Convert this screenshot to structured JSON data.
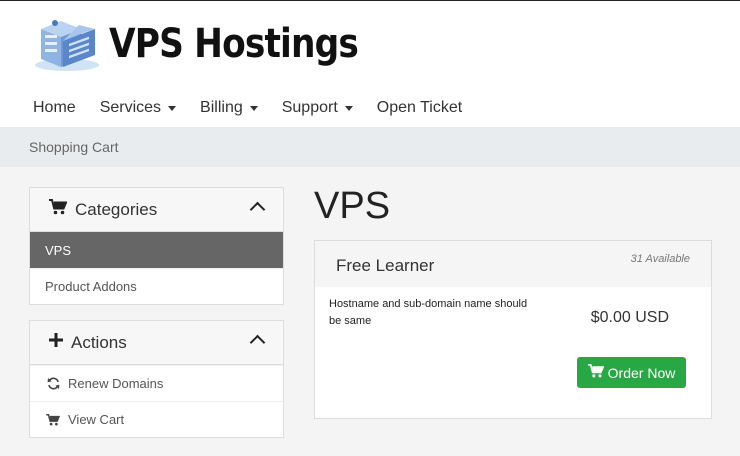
{
  "header": {
    "logo_text": "VPS Hostings",
    "logo_icon": "server-icon"
  },
  "nav": {
    "items": [
      {
        "label": "Home",
        "dropdown": false
      },
      {
        "label": "Services",
        "dropdown": true
      },
      {
        "label": "Billing",
        "dropdown": true
      },
      {
        "label": "Support",
        "dropdown": true
      },
      {
        "label": "Open Ticket",
        "dropdown": false
      }
    ]
  },
  "breadcrumb": {
    "label": "Shopping Cart"
  },
  "categories_panel": {
    "title": "Categories",
    "icon": "cart-icon",
    "items": [
      {
        "label": "VPS",
        "active": true
      },
      {
        "label": "Product Addons",
        "active": false
      }
    ]
  },
  "actions_panel": {
    "title": "Actions",
    "icon": "plus-icon",
    "items": [
      {
        "label": "Renew Domains",
        "icon": "refresh-icon"
      },
      {
        "label": "View Cart",
        "icon": "cart-icon"
      }
    ]
  },
  "main": {
    "title": "VPS",
    "product": {
      "name": "Free Learner",
      "availability": "31 Available",
      "description": "Hostname and sub-domain name should be same",
      "price": "$0.00 USD",
      "order_label": "Order Now"
    }
  },
  "colors": {
    "accent_green": "#28a745",
    "active_row": "#666666",
    "breadcrumb_bg": "#e9ecef"
  }
}
